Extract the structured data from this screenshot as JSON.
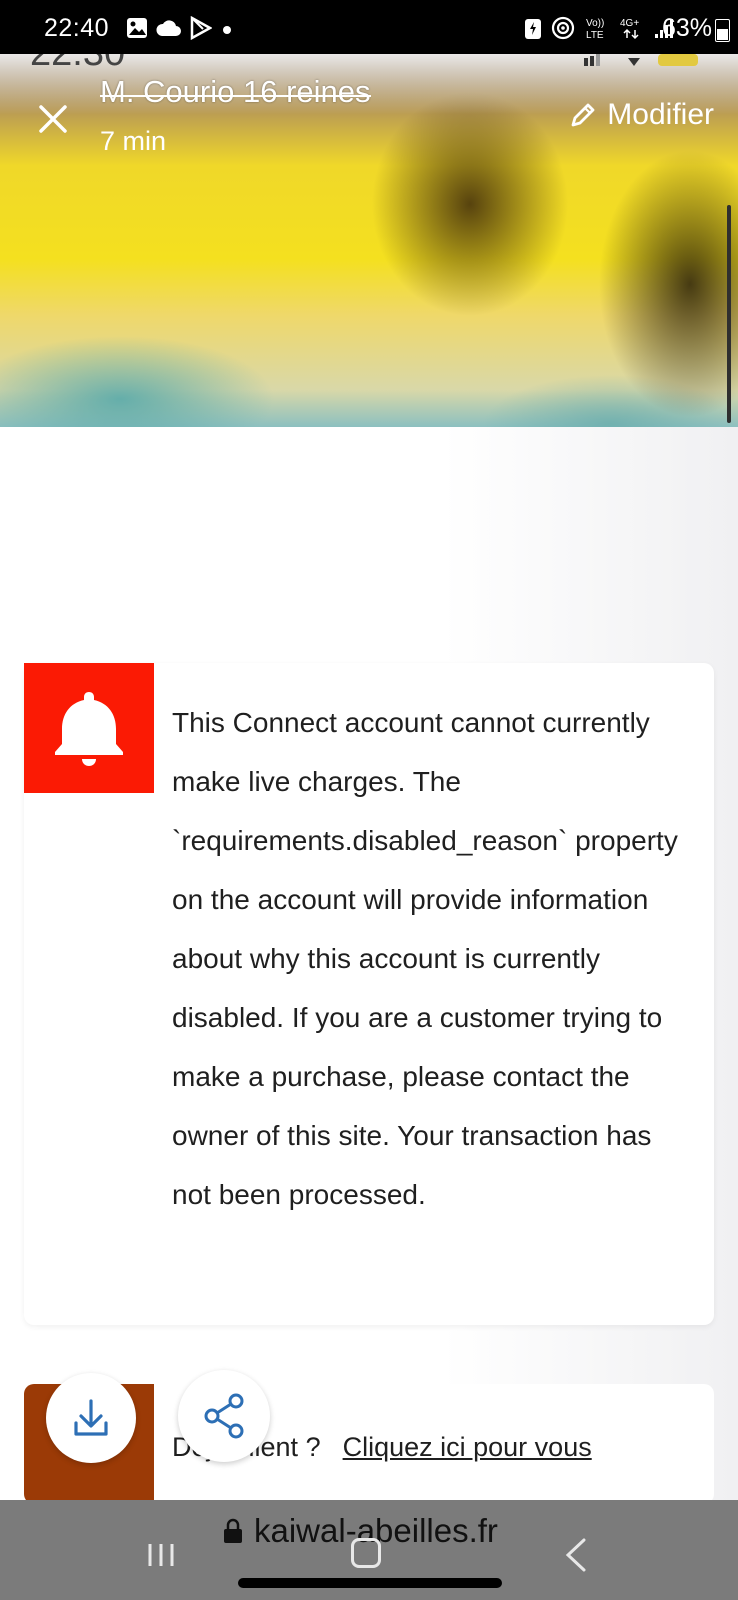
{
  "status_bar": {
    "time": "22:40",
    "battery": "63%",
    "left_icons": [
      "image-icon",
      "cloud-icon",
      "play-store-icon",
      "dot-icon"
    ],
    "right_icons": [
      "battery-saver-icon",
      "hotspot-icon",
      "volte-icon",
      "4g-icon",
      "signal-icon"
    ]
  },
  "media_header": {
    "ghost_time": "22:30",
    "title": "M. Courio 16 reines",
    "duration": "7 min",
    "edit_label": "Modifier"
  },
  "alert": {
    "message": "This Connect account cannot currently make live charges. The `requirements.disabled_reason` property on the account will provide information about why this account is currently disabled. If you are a customer trying to make a purchase, please contact the owner of this site. Your transaction has not been processed.",
    "accent_color": "#fb1a04"
  },
  "promo": {
    "prefix": "Déjà client ?",
    "link_text": "Cliquez ici pour vous"
  },
  "browser_bar": {
    "url": "kaiwal-abeilles.fr"
  }
}
